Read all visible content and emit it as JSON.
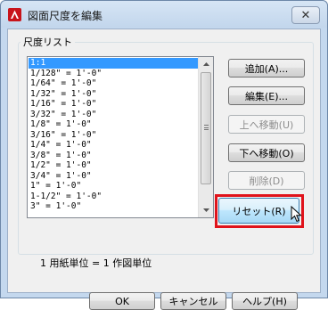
{
  "window": {
    "title": "図面尺度を編集",
    "close_glyph": "✕",
    "icon": "autocad-icon",
    "accent_color": "#c4d8ee"
  },
  "group": {
    "title": "尺度リスト"
  },
  "scale_list": {
    "items": [
      "1:1",
      "1/128\" = 1'-0\"",
      "1/64\" = 1'-0\"",
      "1/32\" = 1'-0\"",
      "1/16\" = 1'-0\"",
      "3/32\" = 1'-0\"",
      "1/8\" = 1'-0\"",
      "3/16\" = 1'-0\"",
      "1/4\" = 1'-0\"",
      "3/8\" = 1'-0\"",
      "1/2\" = 1'-0\"",
      "3/4\" = 1'-0\"",
      "1\" = 1'-0\"",
      "1-1/2\" = 1'-0\"",
      "3\" = 1'-0\""
    ],
    "selected": "1:1",
    "selection_color": "#3399ff"
  },
  "buttons": {
    "add": "追加(A)...",
    "edit": "編集(E)...",
    "move_up": "上へ移動(U)",
    "move_down": "下へ移動(O)",
    "delete": "削除(D)",
    "reset": "リセット(R)",
    "ok": "OK",
    "cancel": "キャンセル",
    "help": "ヘルプ(H)"
  },
  "unit_info": "1 用紙単位 = 1 作図単位",
  "highlight_color": "#e0131b"
}
